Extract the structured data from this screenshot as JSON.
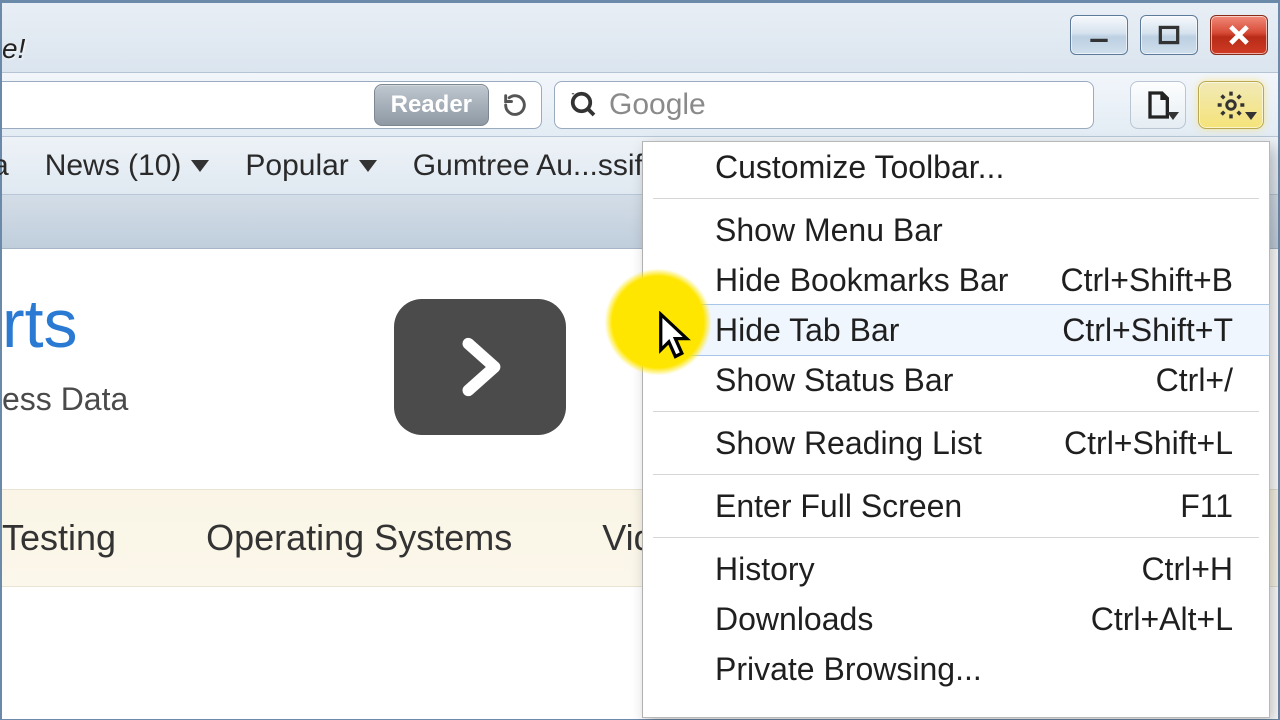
{
  "window": {
    "title_fragment": "e!"
  },
  "toolbar": {
    "reader_label": "Reader",
    "search_placeholder": "Google"
  },
  "bookmarks": {
    "item0": "a",
    "item1": "News (10)",
    "item2": "Popular",
    "item3": "Gumtree Au...ssifieds."
  },
  "page": {
    "headline_fragment": "rts",
    "subline_fragment": "ess Data",
    "cats": {
      "c1": "Testing",
      "c2": "Operating Systems",
      "c3": "Videos"
    }
  },
  "menu": {
    "customize": "Customize Toolbar...",
    "show_menu": "Show Menu Bar",
    "hide_bm": {
      "label": "Hide Bookmarks Bar",
      "accel": "Ctrl+Shift+B"
    },
    "hide_tab": {
      "label": "Hide Tab Bar",
      "accel": "Ctrl+Shift+T"
    },
    "show_status": {
      "label": "Show Status Bar",
      "accel": "Ctrl+/"
    },
    "reading": {
      "label": "Show Reading List",
      "accel": "Ctrl+Shift+L"
    },
    "fullscreen": {
      "label": "Enter Full Screen",
      "accel": "F11"
    },
    "history": {
      "label": "History",
      "accel": "Ctrl+H"
    },
    "downloads": {
      "label": "Downloads",
      "accel": "Ctrl+Alt+L"
    },
    "private": "Private Browsing..."
  }
}
